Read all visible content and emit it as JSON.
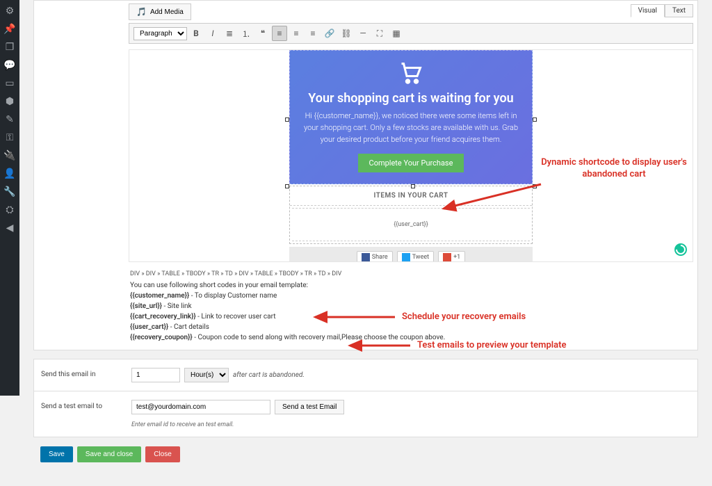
{
  "admin_sidebar_icons": [
    "dashboard",
    "pin",
    "files",
    "comment",
    "square-ad",
    "cube",
    "brush",
    "key",
    "plugin",
    "user",
    "wrench",
    "settings",
    "circle"
  ],
  "editor": {
    "add_media_label": "Add Media",
    "tabs": {
      "visual": "Visual",
      "text": "Text"
    },
    "format_dropdown": "Paragraph",
    "toolbar_buttons": [
      "bold",
      "italic",
      "bullet-list",
      "number-list",
      "blockquote",
      "align-left",
      "align-center",
      "align-right",
      "link",
      "unlink",
      "more",
      "fullscreen",
      "toolbar-toggle"
    ]
  },
  "email_preview": {
    "hero_title": "Your shopping cart is waiting for you",
    "hero_body": "Hi {{customer_name}}, we noticed there were some items left in your shopping cart. Only a few stocks are available with us. Grab your desired product before your friend acquires them.",
    "cta_label": "Complete Your Purchase",
    "items_header": "ITEMS IN YOUR CART",
    "items_placeholder": "{{user_cart}}",
    "social": {
      "share": "Share",
      "tweet": "Tweet",
      "plus": "+1"
    }
  },
  "breadcrumb_path": "DIV » DIV » TABLE » TBODY » TR » TD » DIV » TABLE » TBODY » TR » TD » DIV",
  "shortcodes": {
    "intro": "You can use following short codes in your email template:",
    "items": [
      {
        "code": "{{customer_name}}",
        "desc": "To display Customer name"
      },
      {
        "code": "{{site_url}}",
        "desc": "Site link"
      },
      {
        "code": "{{cart_recovery_link}}",
        "desc": "Link to recover user cart"
      },
      {
        "code": "{{user_cart}}",
        "desc": "Cart details"
      },
      {
        "code": "{{recovery_coupon}}",
        "desc": "Coupon code to send along with recovery mail,Please choose the coupon above."
      }
    ]
  },
  "schedule": {
    "label": "Send this email in",
    "value": "1",
    "unit_selected": "Hour(s)",
    "after_text": "after cart is abandoned."
  },
  "test_email": {
    "label": "Send a test email to",
    "value": "test@yourdomain.com",
    "button": "Send a test Email",
    "hint": "Enter email id to receive an test email."
  },
  "actions": {
    "save": "Save",
    "save_close": "Save and close",
    "close": "Close"
  },
  "annotations": {
    "a1": "Dynamic shortcode to display user's abandoned cart",
    "a2": "Schedule your recovery emails",
    "a3": "Test emails to preview your template"
  }
}
